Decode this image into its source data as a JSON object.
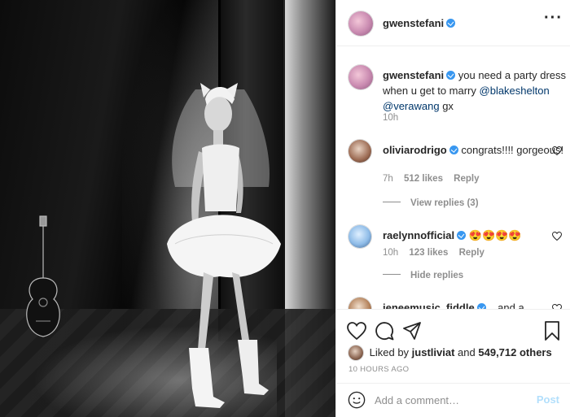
{
  "post": {
    "photo_alt_icon": "photo",
    "author": {
      "username": "gwenstefani",
      "verified": true
    },
    "more_icon": "more-horizontal-icon",
    "caption": {
      "username": "gwenstefani",
      "text": "you need a party dress when u get to marry",
      "mention_1": "@blakeshelton",
      "mention_2": "@verawang",
      "suffix": "gx",
      "time": "10h"
    },
    "comments": [
      {
        "username": "oliviarodrigo",
        "text": "congrats!!!! gorgeous!",
        "time": "7h",
        "likes": "512 likes",
        "reply": "Reply",
        "replies_toggle": "View replies (3)"
      },
      {
        "username": "raelynnofficial",
        "text": "😍😍😍😍",
        "time": "10h",
        "likes": "123 likes",
        "reply": "Reply",
        "replies_toggle": "Hide replies"
      },
      {
        "username": "jeneemusic_fiddle",
        "text": "...and a"
      }
    ],
    "liked_by": {
      "prefix": "Liked by",
      "user": "justliviat",
      "and": "and",
      "others": "549,712 others"
    },
    "timestamp": "10 HOURS AGO",
    "add_comment": {
      "placeholder": "Add a comment…",
      "post_label": "Post"
    }
  },
  "colors": {
    "accent_blue": "#3897f0",
    "mention": "#00376b",
    "muted": "#8e8e8e",
    "post_disabled": "#b2dffc"
  }
}
